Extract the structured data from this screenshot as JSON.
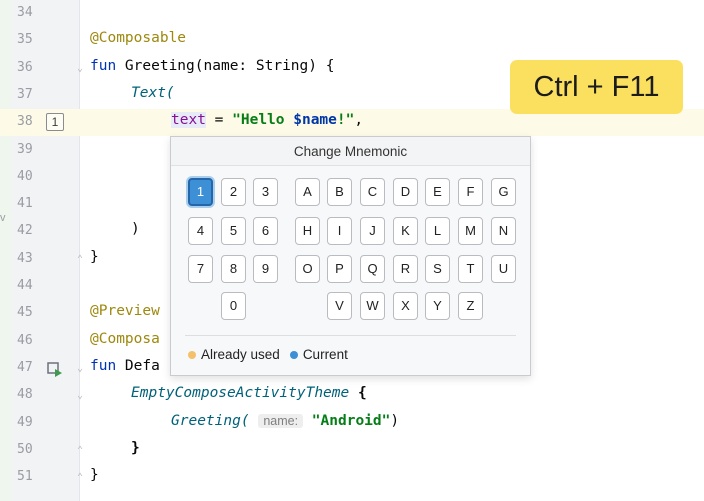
{
  "editor": {
    "lines": [
      {
        "n": "34"
      },
      {
        "n": "35"
      },
      {
        "n": "36"
      },
      {
        "n": "37"
      },
      {
        "n": "38"
      },
      {
        "n": "39"
      },
      {
        "n": "40"
      },
      {
        "n": "41"
      },
      {
        "n": "42"
      },
      {
        "n": "43"
      },
      {
        "n": "44"
      },
      {
        "n": "45"
      },
      {
        "n": "46"
      },
      {
        "n": "47"
      },
      {
        "n": "48"
      },
      {
        "n": "49"
      },
      {
        "n": "50"
      },
      {
        "n": "51"
      }
    ],
    "code": {
      "l35": "@Composable",
      "l36_kw": "fun",
      "l36_rest": " Greeting(name: String) {",
      "l37": "Text(",
      "l38_param": "text",
      "l38_eq": " = ",
      "l38_str1": "\"Hello ",
      "l38_var": "$name",
      "l38_str2": "!\"",
      "l38_comma": ",",
      "l42": ")",
      "l43": "}",
      "l45": "@Preview",
      "l46": "@Composa",
      "l47_kw": "fun",
      "l47_rest": " Defa",
      "l48_fn": "EmptyComposeActivityTheme",
      "l48_rest": " {",
      "l49_fn": "Greeting(",
      "l49_hint": "name:",
      "l49_str": "\"Android\"",
      "l49_close": ")",
      "l50": "}",
      "l51": "}"
    },
    "bookmark_badge": "1",
    "side_letter": "v"
  },
  "shortcut": {
    "label": "Ctrl + F11"
  },
  "popup": {
    "title": "Change Mnemonic",
    "row1_digits": [
      "1",
      "2",
      "3"
    ],
    "row1_letters": [
      "A",
      "B",
      "C",
      "D",
      "E",
      "F",
      "G"
    ],
    "row2_digits": [
      "4",
      "5",
      "6"
    ],
    "row2_letters": [
      "H",
      "I",
      "J",
      "K",
      "L",
      "M",
      "N"
    ],
    "row3_digits": [
      "7",
      "8",
      "9"
    ],
    "row3_letters": [
      "O",
      "P",
      "Q",
      "R",
      "S",
      "T",
      "U"
    ],
    "row4_digits": [
      "0"
    ],
    "row4_letters": [
      "V",
      "W",
      "X",
      "Y",
      "Z"
    ],
    "current_key": "1",
    "legend": {
      "used": "Already used",
      "current": "Current"
    },
    "colors": {
      "used": "#f5c06b",
      "current": "#3d8fd6"
    }
  }
}
